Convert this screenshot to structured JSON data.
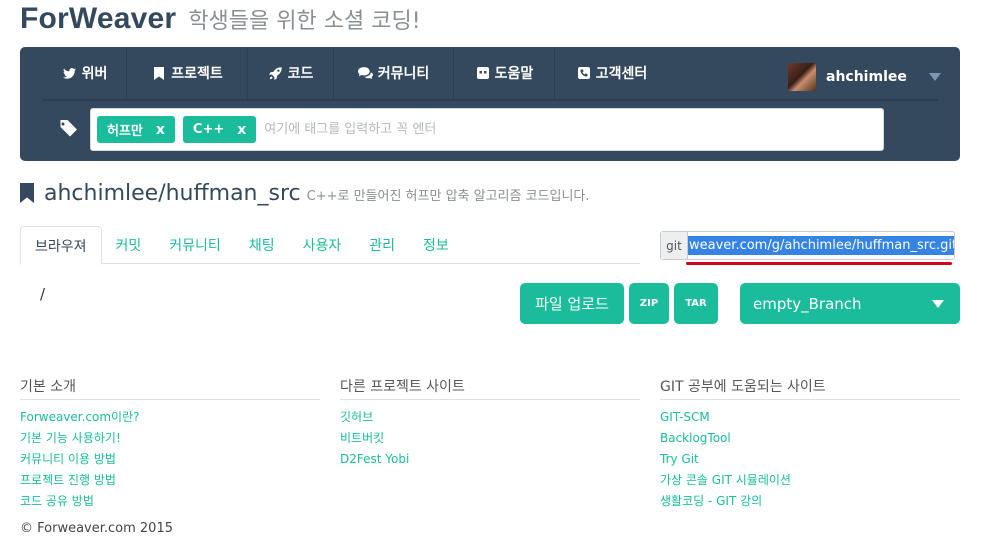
{
  "brand": {
    "name": "ForWeaver",
    "tagline": "학생들을 위한 소셜 코딩!"
  },
  "nav": {
    "items": [
      {
        "label": "위버",
        "icon": "twitter-icon"
      },
      {
        "label": "프로젝트",
        "icon": "bookmark-icon"
      },
      {
        "label": "코드",
        "icon": "rocket-icon"
      },
      {
        "label": "커뮤니티",
        "icon": "comments-icon"
      },
      {
        "label": "도움말",
        "icon": "gamepad-icon"
      },
      {
        "label": "고객센터",
        "icon": "phone-icon"
      }
    ],
    "user": {
      "name": "ahchimlee"
    }
  },
  "tags": {
    "chips": [
      {
        "label": "허프만",
        "remove": "x"
      },
      {
        "label": "C++",
        "remove": "x"
      }
    ],
    "placeholder": "여기에 태그를 입력하고 꼭 엔터"
  },
  "repo": {
    "name": "ahchimlee/huffman_src",
    "description": "C++로 만들어진 허프만 압축 알고리즘 코드입니다."
  },
  "tabs": [
    "브라우져",
    "커밋",
    "커뮤니티",
    "채팅",
    "사용자",
    "관리",
    "정보"
  ],
  "git": {
    "label": "git",
    "url": "weaver.com/g/ahchimlee/huffman_src.git"
  },
  "path": "/",
  "actions": {
    "upload": "파일 업로드",
    "zip": "ZIP",
    "tar": "TAR",
    "branch": "empty_Branch"
  },
  "footer": {
    "columns": [
      {
        "title": "기본 소개",
        "links": [
          "Forweaver.com이란?",
          "기본 기능 사용하기!",
          "커뮤니티 이용 방법",
          "프로젝트 진행 방법",
          "코드 공유 방법"
        ]
      },
      {
        "title": "다른 프로젝트 사이트",
        "links": [
          "깃허브",
          "비트버킷",
          "D2Fest Yobi"
        ]
      },
      {
        "title": "GIT 공부에 도움되는 사이트",
        "links": [
          "GIT-SCM",
          "BacklogTool",
          "Try Git",
          "가상 콘솔 GIT 시뮬레이션",
          "생활코딩 - GIT 강의"
        ]
      }
    ],
    "copyright": "© Forweaver.com 2015"
  },
  "colors": {
    "navbar": "#34495e",
    "accent": "#1abc9c",
    "selection": "#3584e4",
    "underline": "#d0021b"
  }
}
